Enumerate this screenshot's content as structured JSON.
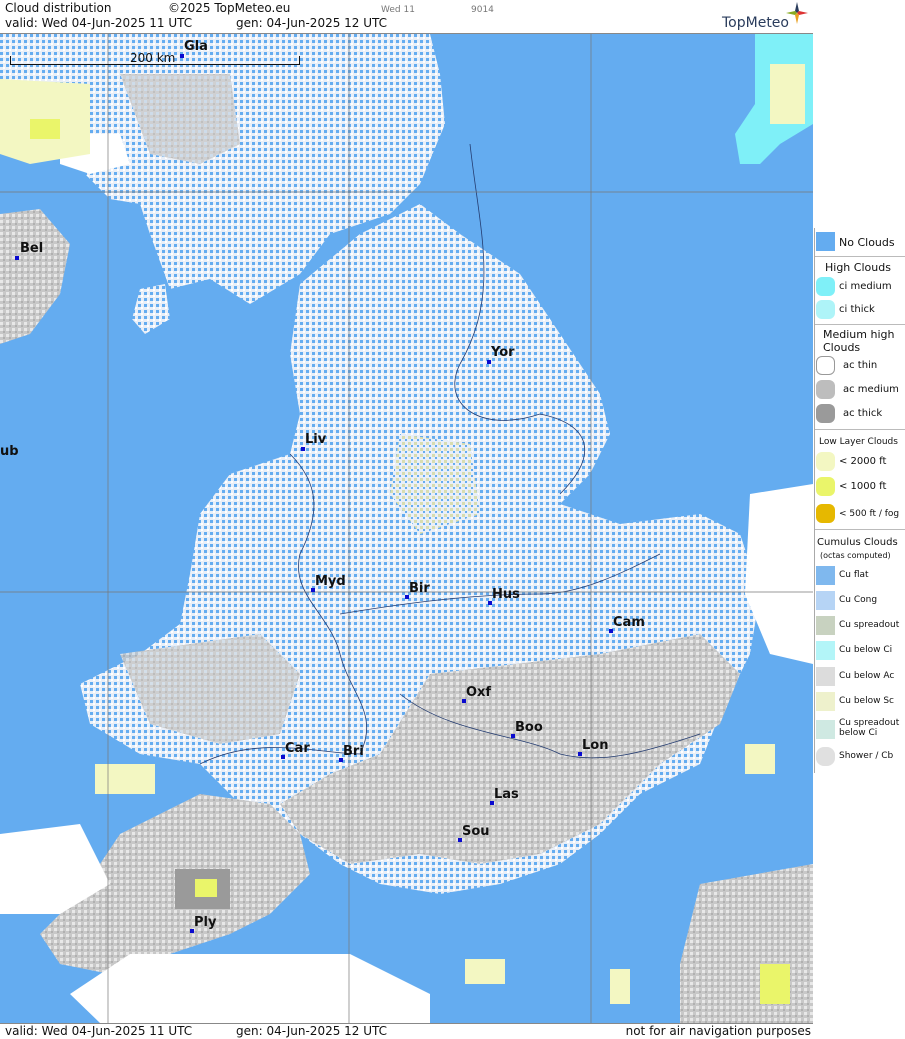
{
  "header": {
    "title": "Cloud distribution",
    "copyright": "©2025 TopMeteo.eu",
    "valid": "valid:  Wed  04-Jun-2025  11 UTC",
    "gen": "gen: 04-Jun-2025 12 UTC",
    "small1": "Wed 11",
    "small2": "9014",
    "brand": "TopMeteo"
  },
  "map": {
    "scale": "200 km",
    "cities": [
      {
        "name": "Gla"
      },
      {
        "name": "Bel"
      },
      {
        "name": "ub"
      },
      {
        "name": "Yor"
      },
      {
        "name": "Liv"
      },
      {
        "name": "Myd"
      },
      {
        "name": "Bir"
      },
      {
        "name": "Hus"
      },
      {
        "name": "Cam"
      },
      {
        "name": "Oxf"
      },
      {
        "name": "Boo"
      },
      {
        "name": "Lon"
      },
      {
        "name": "Car"
      },
      {
        "name": "Bri"
      },
      {
        "name": "Las"
      },
      {
        "name": "Sou"
      },
      {
        "name": "Ply"
      }
    ]
  },
  "footer": {
    "valid": "valid:  Wed  04-Jun-2025  11 UTC",
    "gen": "gen: 04-Jun-2025 12 UTC",
    "note": "not for air navigation purposes"
  },
  "legend": {
    "no_clouds": "No Clouds",
    "high_head": "High Clouds",
    "ci_medium": "ci medium",
    "ci_thick": "ci thick",
    "medium_head1": "Medium high",
    "medium_head2": "Clouds",
    "ac_thin": "ac thin",
    "ac_medium": "ac medium",
    "ac_thick": "ac thick",
    "low_head": "Low Layer Clouds",
    "low_2000": "< 2000 ft",
    "low_1000": "< 1000 ft",
    "low_500": "< 500 ft / fog",
    "cu_head1": "Cumulus Clouds",
    "cu_head2": "(octas computed)",
    "cu_flat": "Cu flat",
    "cu_cong": "Cu Cong",
    "cu_spreadout": "Cu spreadout",
    "cu_below_ci": "Cu below Ci",
    "cu_below_ac": "Cu below Ac",
    "cu_below_sc": "Cu below Sc",
    "cu_spread_ci1": "Cu spreadout",
    "cu_spread_ci2": "below Ci",
    "shower": "Shower / Cb"
  },
  "colors": {
    "sea": "#64acf0",
    "land_cu": "#dfe8f6",
    "ac_medium": "#bdbdbd",
    "ac_thick": "#9a9a9a",
    "low_2000": "#f3f7c2",
    "low_1000": "#eaf56a",
    "low_500": "#e6b800",
    "ci_medium": "#7ff0f8",
    "white": "#ffffff"
  }
}
